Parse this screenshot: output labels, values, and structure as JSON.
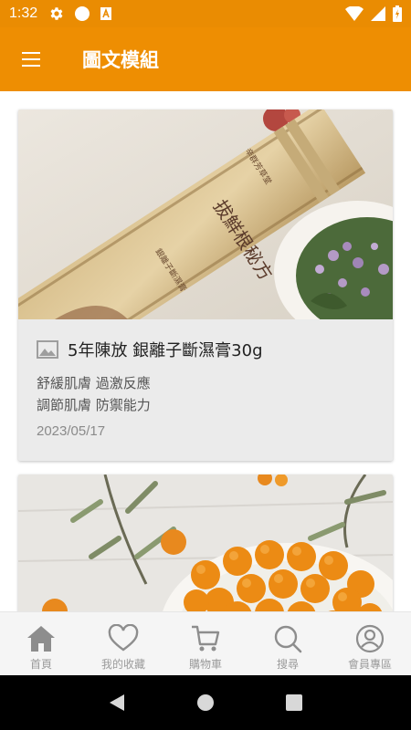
{
  "status_bar": {
    "time": "1:32",
    "left_icons": [
      "gear-icon",
      "circle-icon",
      "a-badge-icon"
    ],
    "right_icons": [
      "wifi-icon",
      "cell-signal-icon",
      "battery-icon"
    ],
    "color": "#ea8c02"
  },
  "app_bar": {
    "title": "圖文模組",
    "menu_icon": "hamburger-menu-icon",
    "color": "#ee8e02"
  },
  "cards": [
    {
      "title": "5年陳放 銀離子斷濕膏30g",
      "desc_line1": "舒緩肌膚 過激反應",
      "desc_line2": "調節肌膚 防禦能力",
      "date": "2023/05/17",
      "image_icon": "image-icon",
      "packet_text": "拔鮮根秘方",
      "packet_brand": "辛群芳草堂",
      "packet_sub": "銀離子斷濕膏"
    },
    {
      "image": "orange-berries-bowl"
    }
  ],
  "bottom_nav": [
    {
      "label": "首頁",
      "icon": "home-icon"
    },
    {
      "label": "我的收藏",
      "icon": "heart-icon"
    },
    {
      "label": "購物車",
      "icon": "cart-icon"
    },
    {
      "label": "搜尋",
      "icon": "search-icon"
    },
    {
      "label": "會員專區",
      "icon": "user-icon"
    }
  ],
  "system_nav": [
    "back-icon",
    "home-circle-icon",
    "recents-icon"
  ]
}
